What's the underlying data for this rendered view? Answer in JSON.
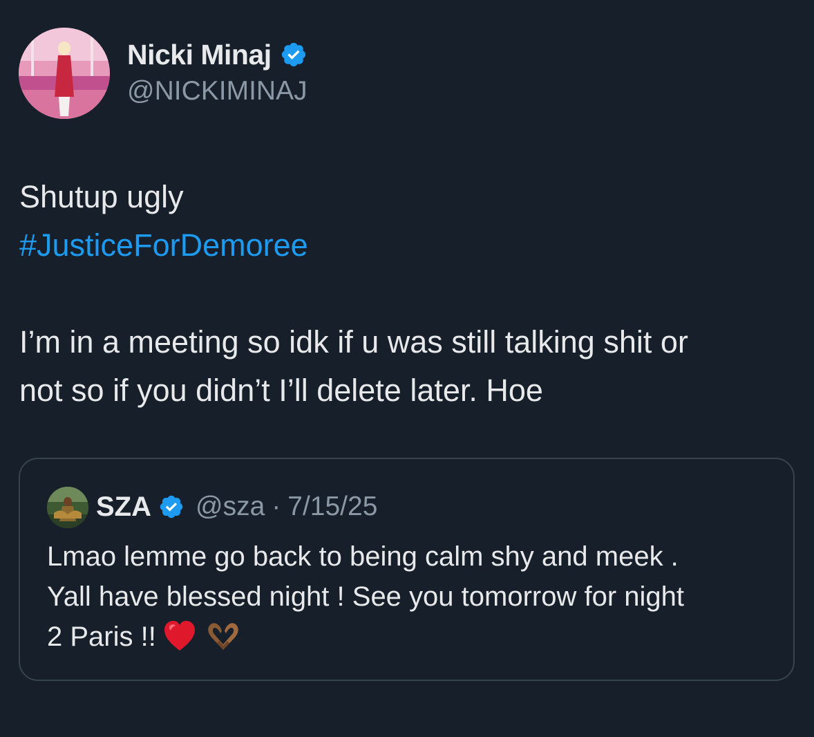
{
  "tweet": {
    "author": {
      "name": "Nicki Minaj",
      "handle": "@NICKIMINAJ",
      "verified": true,
      "avatar_icon": "profile-photo-pink-avatar"
    },
    "text_lines": [
      "Shutup ugly",
      "#JusticeForDemoree",
      "I’m in a meeting so idk if u was still talking shit or",
      "not so if you didn’t I’ll delete later. Hoe"
    ],
    "hashtag_color": "#1d9bf0",
    "quoted": {
      "author": {
        "name": "SZA",
        "handle": "@sza",
        "separator": "·",
        "date": "7/15/25",
        "verified": true,
        "avatar_icon": "profile-photo-green-avatar"
      },
      "text_lines": [
        "Lmao lemme go back to being calm shy and meek .",
        "Yall have blessed night ! See you tomorrow for night",
        "2 Paris !!"
      ],
      "emojis": [
        "red-heart-emoji",
        "heart-hands-emoji"
      ]
    }
  },
  "colors": {
    "background": "#171f2a",
    "text_primary": "#e7e9ea",
    "text_secondary": "#8b98a5",
    "verified_badge": "#1d9bf0",
    "quote_border": "#38444d"
  }
}
